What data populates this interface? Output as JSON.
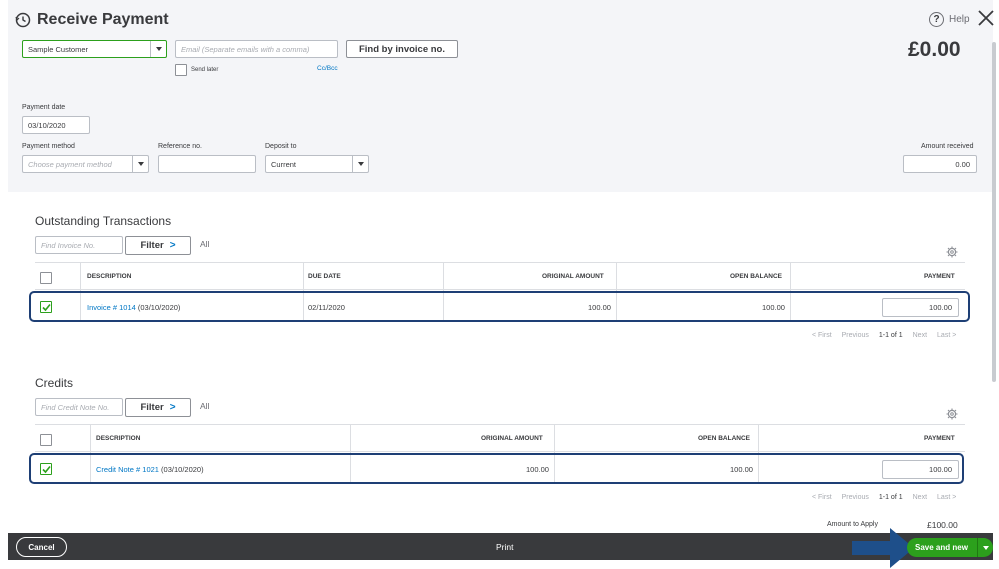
{
  "header": {
    "title": "Receive Payment",
    "help_label": "Help",
    "amount_display": "£0.00"
  },
  "customer": {
    "value": "Sample Customer"
  },
  "email": {
    "placeholder": "Email (Separate emails with a comma)"
  },
  "find_by_invoice_label": "Find by invoice no.",
  "send_later_label": "Send later",
  "cc_bcc_label": "Cc/Bcc",
  "payment_date": {
    "label": "Payment date",
    "value": "03/10/2020"
  },
  "payment_method": {
    "label": "Payment method",
    "placeholder": "Choose payment method"
  },
  "reference": {
    "label": "Reference no.",
    "value": ""
  },
  "deposit_to": {
    "label": "Deposit to",
    "value": "Current"
  },
  "amount_received": {
    "label": "Amount received",
    "value": "0.00"
  },
  "outstanding": {
    "title": "Outstanding Transactions",
    "search_placeholder": "Find Invoice No.",
    "filter_label": "Filter",
    "all_label": "All",
    "columns": [
      "DESCRIPTION",
      "DUE DATE",
      "ORIGINAL AMOUNT",
      "OPEN BALANCE",
      "PAYMENT"
    ],
    "rows": [
      {
        "link": "Invoice # 1014",
        "date_suffix": " (03/10/2020)",
        "due_date": "02/11/2020",
        "original": "100.00",
        "open": "100.00",
        "payment": "100.00"
      }
    ],
    "pager": {
      "first": "< First",
      "previous": "Previous",
      "range": "1-1 of 1",
      "next": "Next",
      "last": "Last >"
    }
  },
  "credits": {
    "title": "Credits",
    "search_placeholder": "Find Credit Note No.",
    "filter_label": "Filter",
    "all_label": "All",
    "columns": [
      "DESCRIPTION",
      "ORIGINAL AMOUNT",
      "OPEN BALANCE",
      "PAYMENT"
    ],
    "rows": [
      {
        "link": "Credit Note # 1021",
        "date_suffix": " (03/10/2020)",
        "original": "100.00",
        "open": "100.00",
        "payment": "100.00"
      }
    ],
    "pager": {
      "first": "< First",
      "previous": "Previous",
      "range": "1-1 of 1",
      "next": "Next",
      "last": "Last >"
    }
  },
  "amount_to_apply": {
    "label": "Amount to Apply",
    "value": "£100.00"
  },
  "footer": {
    "cancel_label": "Cancel",
    "print_label": "Print",
    "save_label": "Save and new"
  },
  "colors": {
    "accent_green": "#2ca01c",
    "link_blue": "#0077c5",
    "highlight_navy": "#1e3f75",
    "footer_bg": "#393a3d"
  }
}
